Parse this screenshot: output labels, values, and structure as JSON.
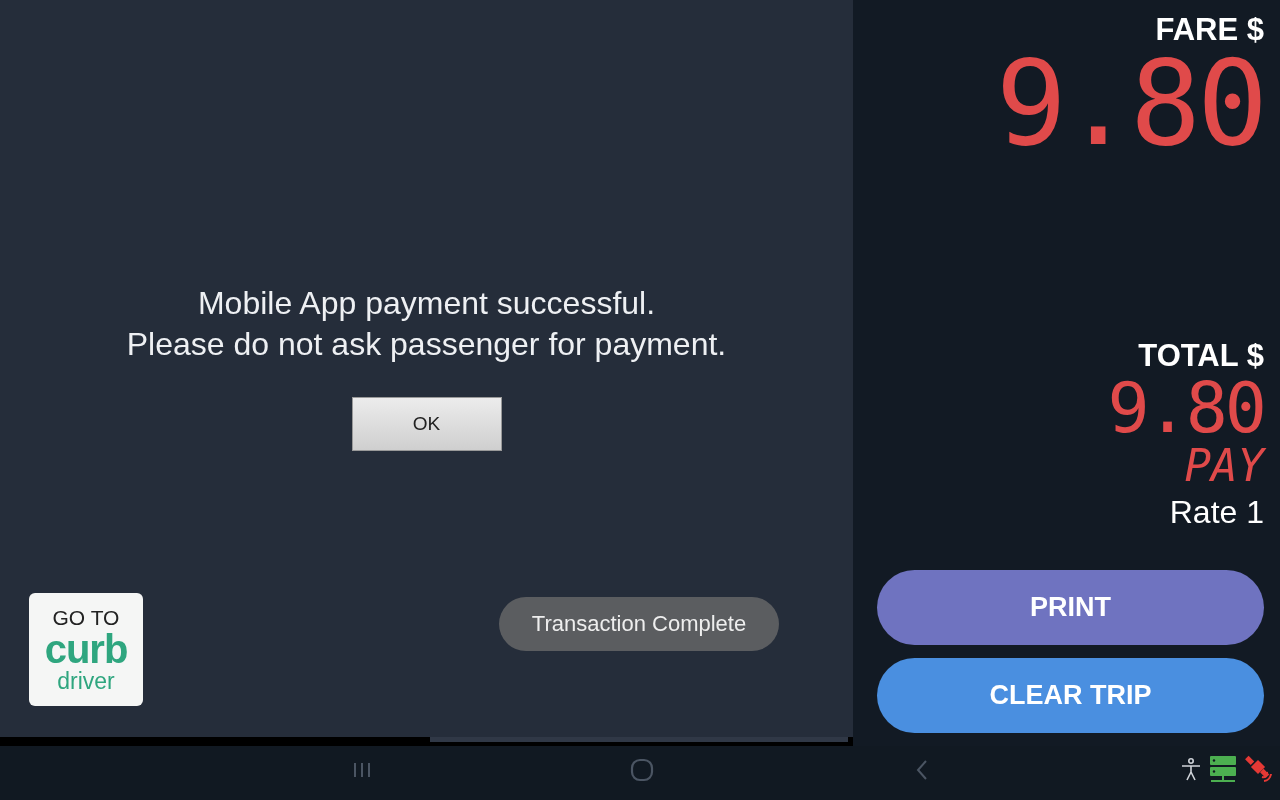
{
  "dialog": {
    "message_lines": [
      "Mobile App payment successful.",
      "Please do not ask passenger for payment."
    ],
    "button": "OK"
  },
  "curb_badge": {
    "line_1": "GO TO",
    "logo": "curb",
    "line_2": "driver"
  },
  "toast": "Transaction Complete",
  "meter": {
    "fare_label": "FARE $",
    "fare": "9.80",
    "total_label": "TOTAL $",
    "total": "9.80",
    "status": "PAY",
    "rate": "Rate 1"
  },
  "buttons": [
    {
      "label": "PRINT",
      "color": "#6f73c0"
    },
    {
      "label": "CLEAR TRIP",
      "color": "#4a8fe0"
    }
  ]
}
